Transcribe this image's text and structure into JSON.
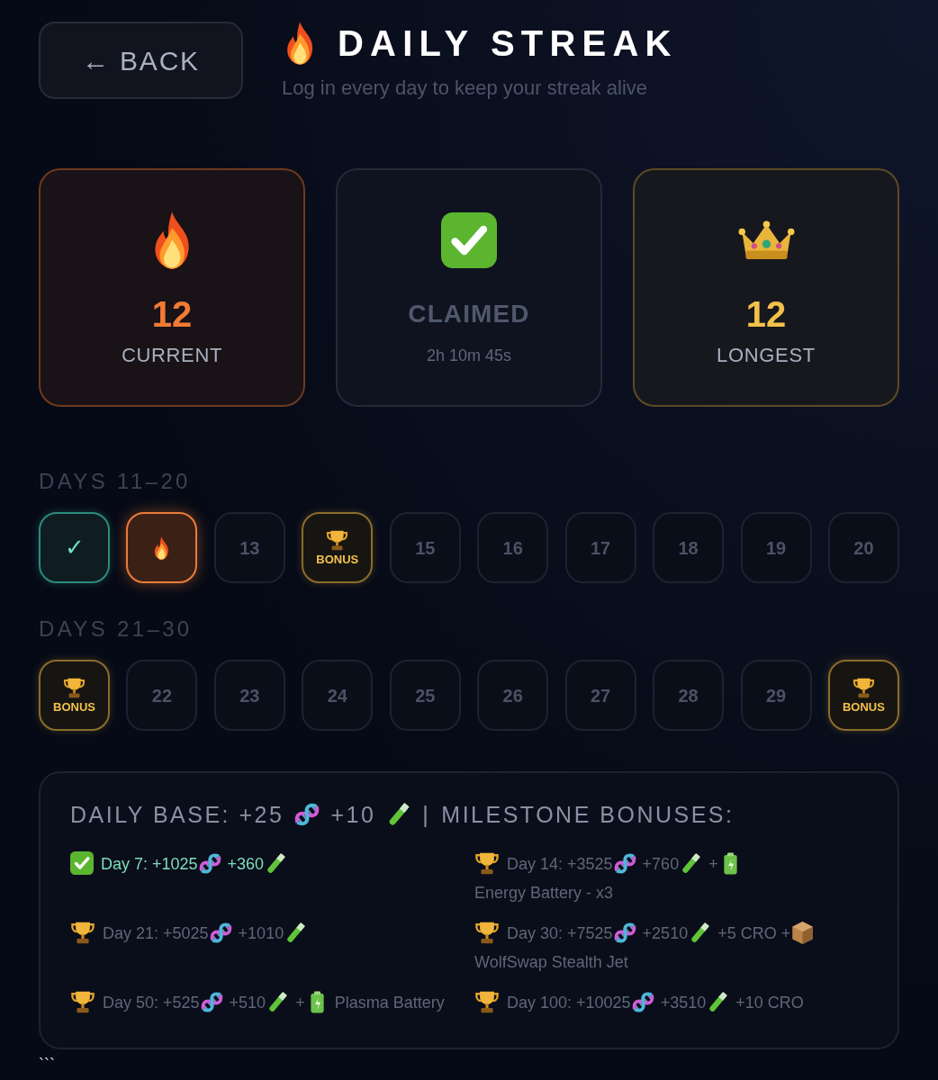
{
  "header": {
    "back_button": "← BACK",
    "title": "DAILY STREAK",
    "subtitle": "Log in every day to keep your streak alive"
  },
  "stats": [
    {
      "kind": "current",
      "value": "12",
      "label": "CURRENT"
    },
    {
      "kind": "claimed",
      "value": "CLAIMED",
      "label": "2h 10m 45s"
    },
    {
      "kind": "longest",
      "value": "12",
      "label": "LONGEST"
    }
  ],
  "day_groups": [
    {
      "title": "DAYS 11–20",
      "days": [
        {
          "kind": "done",
          "label": "✓"
        },
        {
          "kind": "today"
        },
        {
          "kind": "locked",
          "label": "13"
        },
        {
          "kind": "bonus",
          "label": "BONUS"
        },
        {
          "kind": "locked",
          "label": "15"
        },
        {
          "kind": "locked",
          "label": "16"
        },
        {
          "kind": "locked",
          "label": "17"
        },
        {
          "kind": "locked",
          "label": "18"
        },
        {
          "kind": "locked",
          "label": "19"
        },
        {
          "kind": "locked",
          "label": "20"
        }
      ]
    },
    {
      "title": "DAYS 21–30",
      "days": [
        {
          "kind": "bonus",
          "label": "BONUS"
        },
        {
          "kind": "locked",
          "label": "22"
        },
        {
          "kind": "locked",
          "label": "23"
        },
        {
          "kind": "locked",
          "label": "24"
        },
        {
          "kind": "locked",
          "label": "25"
        },
        {
          "kind": "locked",
          "label": "26"
        },
        {
          "kind": "locked",
          "label": "27"
        },
        {
          "kind": "locked",
          "label": "28"
        },
        {
          "kind": "locked",
          "label": "29"
        },
        {
          "kind": "bonus",
          "label": "BONUS"
        }
      ]
    }
  ],
  "rewards": {
    "heading": [
      {
        "kind": "text",
        "text": "DAILY BASE: +25"
      },
      {
        "kind": "dna"
      },
      {
        "kind": "text",
        "text": "+10"
      },
      {
        "kind": "tube"
      },
      {
        "kind": "text",
        "text": "|"
      },
      {
        "kind": "text",
        "text": "MILESTONE BONUSES:"
      }
    ],
    "milestones": [
      {
        "claimed": true,
        "parts": [
          {
            "kind": "text",
            "text": "Day 7: +1025"
          },
          {
            "kind": "dna"
          },
          {
            "kind": "text",
            "text": "+360"
          },
          {
            "kind": "tube"
          }
        ]
      },
      {
        "claimed": false,
        "parts": [
          {
            "kind": "text",
            "text": "Day 14: +3525"
          },
          {
            "kind": "dna"
          },
          {
            "kind": "text",
            "text": "+760"
          },
          {
            "kind": "tube"
          },
          {
            "kind": "text",
            "text": "+"
          },
          {
            "kind": "battery"
          },
          {
            "kind": "text",
            "text": "Energy Battery - x3"
          }
        ]
      },
      {
        "claimed": false,
        "parts": [
          {
            "kind": "text",
            "text": "Day 21: +5025"
          },
          {
            "kind": "dna"
          },
          {
            "kind": "text",
            "text": "+1010"
          },
          {
            "kind": "tube"
          }
        ]
      },
      {
        "claimed": false,
        "parts": [
          {
            "kind": "text",
            "text": "Day 30: +7525"
          },
          {
            "kind": "dna"
          },
          {
            "kind": "text",
            "text": "+2510"
          },
          {
            "kind": "tube"
          },
          {
            "kind": "text",
            "text": "+5 CRO +"
          },
          {
            "kind": "box"
          },
          {
            "kind": "text",
            "text": "WolfSwap Stealth Jet"
          }
        ]
      },
      {
        "claimed": false,
        "parts": [
          {
            "kind": "text",
            "text": "Day 50: +525"
          },
          {
            "kind": "dna"
          },
          {
            "kind": "text",
            "text": "+510"
          },
          {
            "kind": "tube"
          },
          {
            "kind": "text",
            "text": "+"
          },
          {
            "kind": "battery"
          },
          {
            "kind": "text",
            "text": "Plasma Battery"
          }
        ]
      },
      {
        "claimed": false,
        "parts": [
          {
            "kind": "text",
            "text": "Day 100: +10025"
          },
          {
            "kind": "dna"
          },
          {
            "kind": "text",
            "text": "+3510"
          },
          {
            "kind": "tube"
          },
          {
            "kind": "text",
            "text": "+10 CRO"
          }
        ]
      }
    ]
  },
  "footer_text": "```"
}
